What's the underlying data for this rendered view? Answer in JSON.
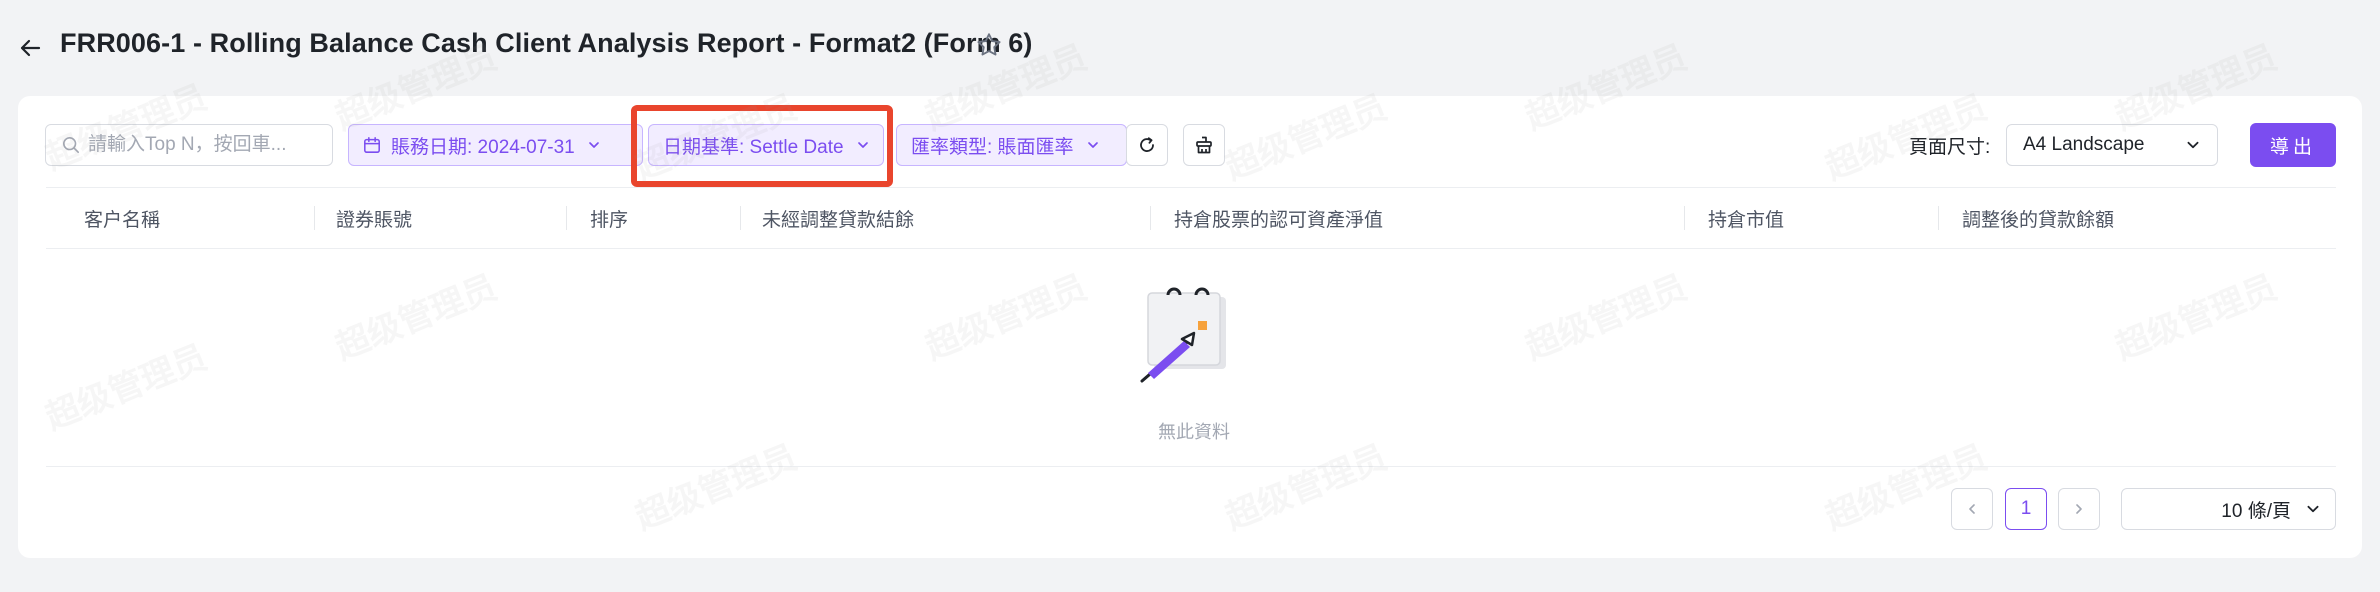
{
  "header": {
    "title": "FRR006-1 - Rolling Balance Cash Client Analysis Report - Format2 (Form 6)",
    "back_icon": "arrow-left-icon",
    "favorite_icon": "star-outline-icon"
  },
  "toolbar": {
    "search": {
      "placeholder": "請輸入Top N，按回車..."
    },
    "filters": {
      "business_date": "賬務日期: 2024-07-31",
      "date_basis": "日期基準: Settle Date",
      "rate_type": "匯率類型: 賬面匯率"
    },
    "refresh_icon": "refresh-icon",
    "clear_icon": "clear-filter-icon",
    "page_size_label": "頁面尺寸:",
    "page_size_value": "A4 Landscape",
    "export_label": "導出"
  },
  "table": {
    "columns": [
      "客户名稱",
      "證券賬號",
      "排序",
      "未經調整貸款結餘",
      "持倉股票的認可資產淨值",
      "持倉市值",
      "調整後的貸款餘額"
    ],
    "empty_text": "無此資料"
  },
  "pagination": {
    "current_page": "1",
    "per_page": "10 條/頁"
  },
  "watermark": {
    "text": "超级管理员"
  },
  "colors": {
    "accent": "#7b4df0",
    "accent_bg": "#f2edff",
    "highlight": "#e9452d",
    "page_bg": "#f2f3f5"
  }
}
